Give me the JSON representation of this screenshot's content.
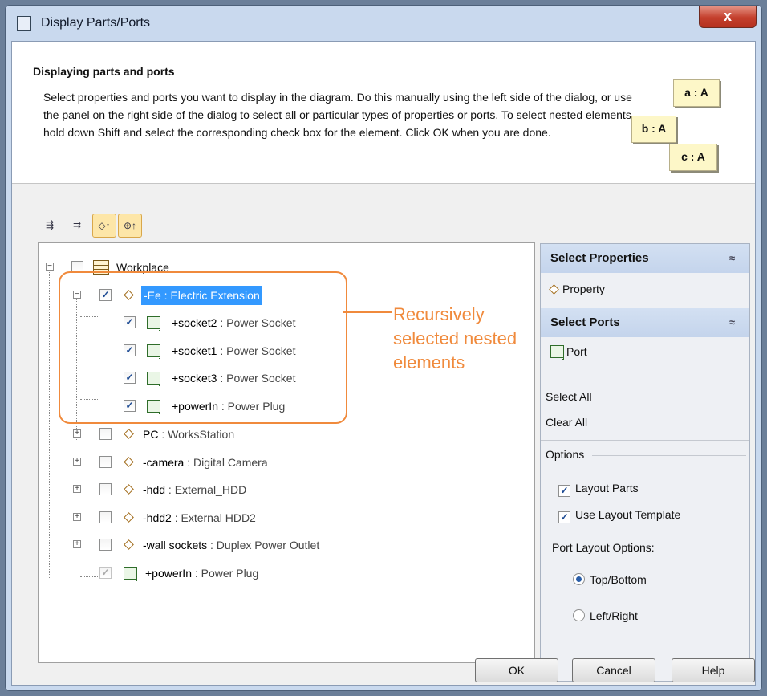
{
  "window": {
    "title": "Display Parts/Ports",
    "close_glyph": "x"
  },
  "header": {
    "title": "Displaying parts and ports",
    "description": "Select properties and ports you want to display in the diagram. Do this manually using the left side of the dialog, or use the panel on the right side of the dialog to select all or particular types of properties or ports. To select nested elements, hold down Shift and select the corresponding check box for the element. Click OK when you are done.",
    "tags": [
      "a : A",
      "b : A",
      "c : A"
    ]
  },
  "toolbar": {
    "icons": [
      "expand-all-icon",
      "collapse-all-icon",
      "show-properties-icon",
      "show-ports-icon"
    ]
  },
  "tree": {
    "root": {
      "name": "Workplace",
      "checked": false
    },
    "ee": {
      "name": "-Ee",
      "type": " : Electric Extension",
      "checked": true,
      "selected": true
    },
    "nested": [
      {
        "name": "+socket2",
        "type": " : Power Socket",
        "checked": true
      },
      {
        "name": "+socket1",
        "type": " : Power Socket",
        "checked": true
      },
      {
        "name": "+socket3",
        "type": " : Power Socket",
        "checked": true
      },
      {
        "name": "+powerIn",
        "type": " : Power Plug",
        "checked": true
      }
    ],
    "parts": [
      {
        "name": "PC",
        "type": " : WorksStation",
        "checked": false
      },
      {
        "name": "-camera",
        "type": " : Digital Camera",
        "checked": false
      },
      {
        "name": "-hdd",
        "type": " : External_HDD",
        "checked": false
      },
      {
        "name": "-hdd2",
        "type": " : External HDD2",
        "checked": false
      },
      {
        "name": "-wall sockets",
        "type": " : Duplex Power Outlet",
        "checked": false
      }
    ],
    "root_port": {
      "name": "+powerIn",
      "type": " : Power Plug",
      "checked": true,
      "disabled": true
    }
  },
  "annotation": {
    "line1": "Recursively",
    "line2": "selected nested",
    "line3": "elements",
    "color": "#f08a3c"
  },
  "right_panel": {
    "select_properties": {
      "title": "Select Properties",
      "item": "Property"
    },
    "select_ports": {
      "title": "Select Ports",
      "item": "Port"
    },
    "select_all": "Select All",
    "clear_all": "Clear All",
    "options_title": "Options",
    "layout_parts": {
      "label": "Layout Parts",
      "checked": true
    },
    "use_layout_template": {
      "label": "Use Layout Template",
      "checked": true
    },
    "port_layout_title": "Port Layout Options:",
    "top_bottom": {
      "label": "Top/Bottom",
      "selected": true
    },
    "left_right": {
      "label": "Left/Right",
      "selected": false
    }
  },
  "buttons": {
    "ok": "OK",
    "cancel": "Cancel",
    "help": "Help"
  },
  "check_glyph": "✓",
  "plus_glyph": "+",
  "minus_glyph": "−"
}
